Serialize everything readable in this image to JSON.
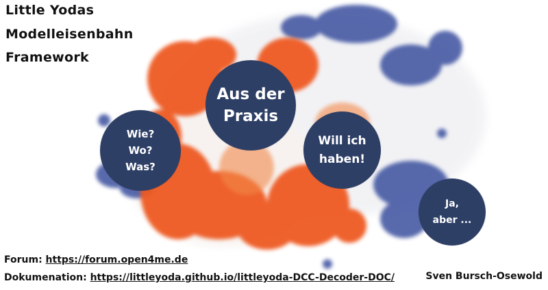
{
  "title": {
    "lines": [
      "Little Yodas",
      "Modelleisenbahn",
      "Framework"
    ]
  },
  "bubbles": {
    "praxis": {
      "line1": "Aus der",
      "line2": "Praxis"
    },
    "wwo": {
      "line1": "Wie?",
      "line2": "Wo?",
      "line3": "Was?"
    },
    "haben": {
      "line1": "Will ich",
      "line2": "haben!"
    },
    "aber": {
      "line1": "Ja,",
      "line2": "aber ..."
    }
  },
  "footer": {
    "forum_label": "Forum:",
    "forum_url": "https://forum.open4me.de",
    "doc_label": "Dokumenation:",
    "doc_url": "https://littleyoda.github.io/littleyoda-DCC-Decoder-DOC/"
  },
  "author": "Sven Bursch-Osewold",
  "colors": {
    "bubble": "#2e3f66",
    "orange": "#ee5a22",
    "blue": "#3a4f9e",
    "text": "#111111"
  }
}
